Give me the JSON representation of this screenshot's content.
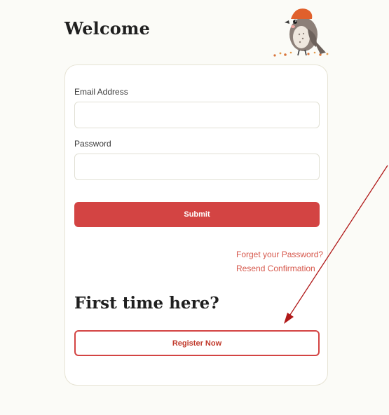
{
  "header": {
    "title": "Welcome"
  },
  "form": {
    "email_label": "Email Address",
    "email_value": "",
    "password_label": "Password",
    "password_value": "",
    "submit_label": "Submit"
  },
  "links": {
    "forgot_password": "Forget your Password?",
    "resend_confirmation": "Resend Confirmation"
  },
  "register": {
    "heading": "First time here?",
    "button_label": "Register Now"
  },
  "icons": {
    "mascot": "bird-mascot-icon",
    "annotation": "red-arrow-icon"
  },
  "colors": {
    "accent": "#d34443",
    "link": "#d6574b",
    "annotation_arrow": "#b01818",
    "background": "#fbfbf7"
  }
}
